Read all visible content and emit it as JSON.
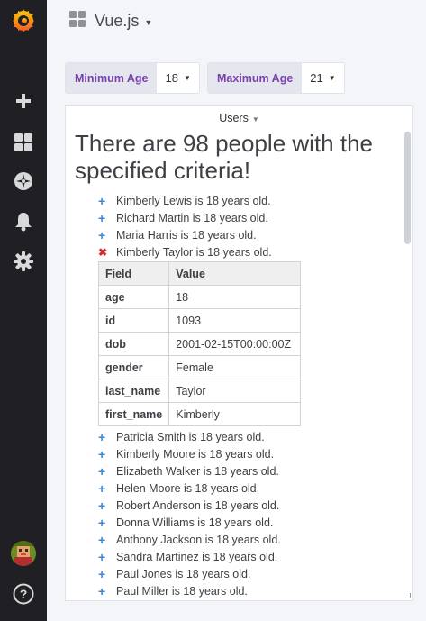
{
  "sidebar": {
    "items": [
      {
        "name": "grafana-logo-icon"
      },
      {
        "name": "plus-icon"
      },
      {
        "name": "dashboards-icon"
      },
      {
        "name": "explore-compass-icon"
      },
      {
        "name": "alerting-bell-icon"
      },
      {
        "name": "configuration-gear-icon"
      },
      {
        "name": "user-avatar-icon"
      },
      {
        "name": "help-icon"
      }
    ]
  },
  "dashboard": {
    "title": "Vue.js"
  },
  "variables": {
    "min_label": "Minimum Age",
    "min_value": "18",
    "max_label": "Maximum Age",
    "max_value": "21"
  },
  "panel": {
    "title": "Users",
    "heading": "There are 98 people with the specified criteria!",
    "people_before": [
      "Kimberly Lewis is 18 years old.",
      "Richard Martin is 18 years old.",
      "Maria Harris is 18 years old."
    ],
    "expanded_person": "Kimberly Taylor is 18 years old.",
    "details": {
      "header_field": "Field",
      "header_value": "Value",
      "rows": [
        {
          "field": "age",
          "value": "18"
        },
        {
          "field": "id",
          "value": "1093"
        },
        {
          "field": "dob",
          "value": "2001-02-15T00:00:00Z"
        },
        {
          "field": "gender",
          "value": "Female"
        },
        {
          "field": "last_name",
          "value": "Taylor"
        },
        {
          "field": "first_name",
          "value": "Kimberly"
        }
      ]
    },
    "people_after": [
      "Patricia Smith is 18 years old.",
      "Kimberly Moore is 18 years old.",
      "Elizabeth Walker is 18 years old.",
      "Helen Moore is 18 years old.",
      "Robert Anderson is 18 years old.",
      "Donna Williams is 18 years old.",
      "Anthony Jackson is 18 years old.",
      "Sandra Martinez is 18 years old.",
      "Paul Jones is 18 years old.",
      "Paul Miller is 18 years old."
    ]
  },
  "colors": {
    "sidebar_bg": "#1f1f24",
    "accent_purple": "#7b3fb0",
    "plus_blue": "#3d86d6",
    "close_red": "#d32f2f"
  }
}
